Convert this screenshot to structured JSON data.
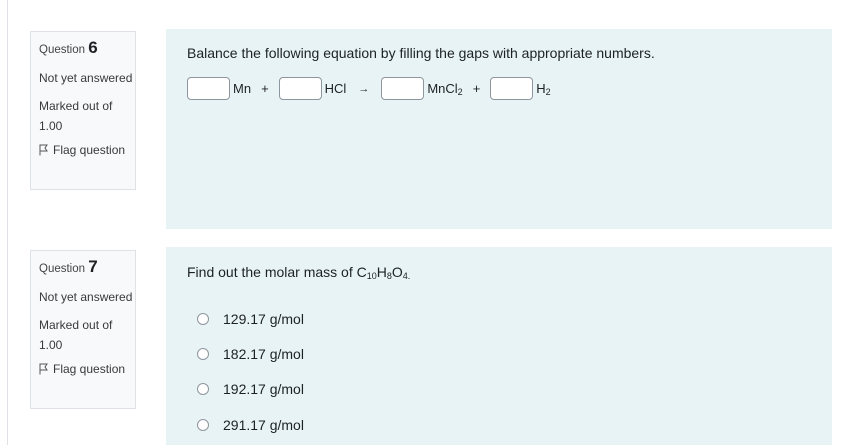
{
  "q6": {
    "label": "Question",
    "number": "6",
    "state": "Not yet answered",
    "grade": "Marked out of 1.00",
    "flag": "Flag question",
    "text": "Balance the following equation by filling the gaps with appropriate numbers.",
    "equation": {
      "s1": "Mn",
      "plus1": "+",
      "s2": "HCl",
      "arrow": "→",
      "s3_main": "MnCl",
      "s3_sub": "2",
      "plus2": "+",
      "s4_main": "H",
      "s4_sub": "2"
    }
  },
  "q7": {
    "label": "Question",
    "number": "7",
    "state": "Not yet answered",
    "grade": "Marked out of 1.00",
    "flag": "Flag question",
    "text_prefix": "Find out the molar mass of C",
    "formula": {
      "c_sub": "10",
      "h": "H",
      "h_sub": "8",
      "o": "O",
      "o_sub": "4."
    },
    "options": [
      "129.17 g/mol",
      "182.17 g/mol",
      "192.17 g/mol",
      "291.17 g/mol"
    ]
  }
}
